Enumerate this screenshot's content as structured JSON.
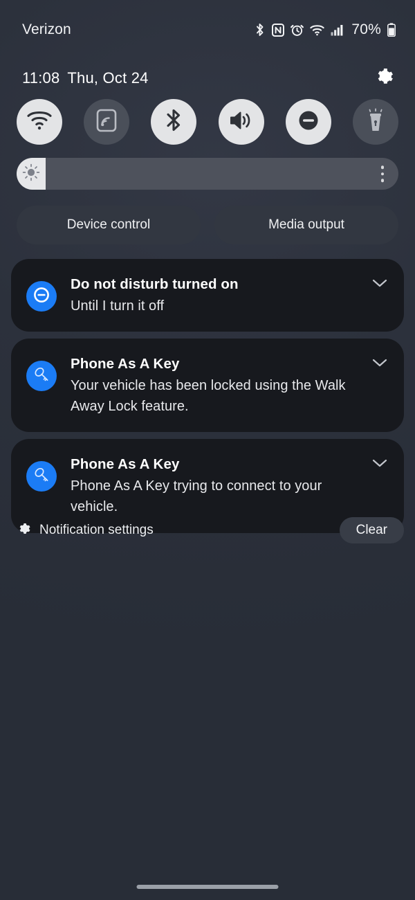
{
  "status_bar": {
    "carrier": "Verizon",
    "battery_percent": "70%",
    "icons": [
      "bluetooth-icon",
      "nfc-icon",
      "alarm-icon",
      "wifi-icon",
      "cellular-signal-icon",
      "battery-icon"
    ]
  },
  "clock": {
    "time": "11:08",
    "date": "Thu, Oct 24",
    "settings_icon": "gear-icon"
  },
  "quick_settings": {
    "tiles": [
      {
        "name": "wifi",
        "icon": "wifi-icon",
        "state": "on"
      },
      {
        "name": "smart-view",
        "icon": "cast-icon",
        "state": "off"
      },
      {
        "name": "bluetooth",
        "icon": "bluetooth-icon",
        "state": "on"
      },
      {
        "name": "sound",
        "icon": "volume-icon",
        "state": "on"
      },
      {
        "name": "do-not-disturb",
        "icon": "dnd-icon",
        "state": "on"
      },
      {
        "name": "flashlight",
        "icon": "flashlight-icon",
        "state": "off"
      }
    ]
  },
  "brightness": {
    "level_percent": 7,
    "icon": "brightness-sun-icon",
    "menu_icon": "more-vertical-icon"
  },
  "shortcuts": {
    "device_control": "Device control",
    "media_output": "Media output"
  },
  "notifications": [
    {
      "icon": "dnd-icon",
      "title": "Do not disturb turned on",
      "text": "Until I turn it off",
      "expand_icon": "chevron-down-icon"
    },
    {
      "icon": "key-icon",
      "title": "Phone As A Key",
      "text": "Your vehicle has been locked using the Walk Away Lock feature.",
      "expand_icon": "chevron-down-icon"
    },
    {
      "icon": "key-icon",
      "title": "Phone As A Key",
      "text": "Phone As A Key trying to connect to your vehicle.",
      "expand_icon": "chevron-down-icon"
    }
  ],
  "footer": {
    "settings_icon": "gear-icon",
    "settings_label": "Notification settings",
    "clear_label": "Clear"
  },
  "colors": {
    "background": "#2c313c",
    "notification_card": "#17191e",
    "accent_blue": "#1b7cf5",
    "tile_on": "#e3e4e6",
    "tile_off": "#4a4f59"
  }
}
